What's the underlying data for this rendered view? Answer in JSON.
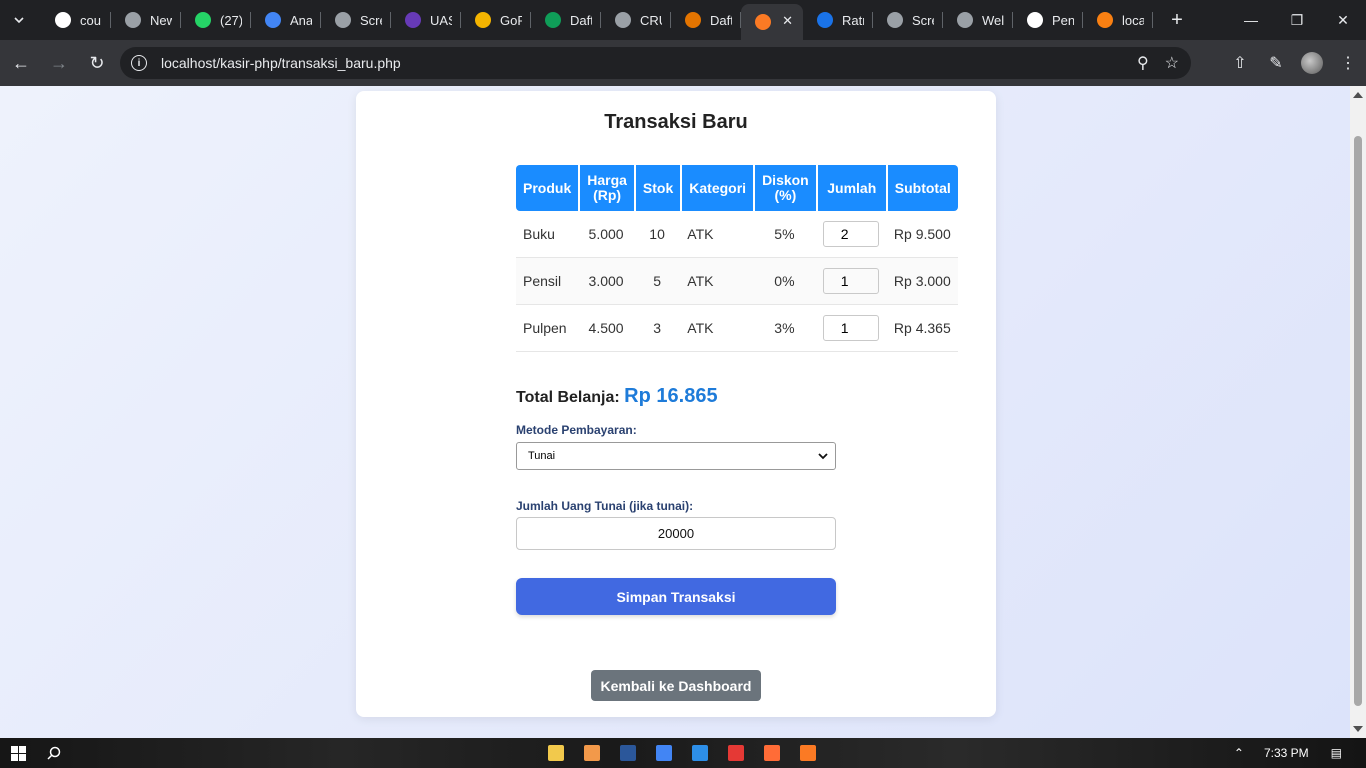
{
  "browser": {
    "tabs": [
      {
        "title": "cou",
        "icon": "google-icon",
        "color": "#ffffff"
      },
      {
        "title": "New",
        "icon": "chrome-icon",
        "color": "#9aa0a6"
      },
      {
        "title": "(27)",
        "icon": "whatsapp-icon",
        "color": "#25d366"
      },
      {
        "title": "Ana",
        "icon": "analytics-icon",
        "color": "#4285f4"
      },
      {
        "title": "Scre",
        "icon": "camera-icon",
        "color": "#9aa0a6"
      },
      {
        "title": "UAS",
        "icon": "forms-icon",
        "color": "#673ab7"
      },
      {
        "title": "GoF",
        "icon": "slides-icon",
        "color": "#f4b400"
      },
      {
        "title": "Daft",
        "icon": "sheets-icon",
        "color": "#0f9d58"
      },
      {
        "title": "CRU",
        "icon": "web-icon",
        "color": "#9aa0a6"
      },
      {
        "title": "Daft",
        "icon": "chart-icon",
        "color": "#e37400"
      },
      {
        "title": "",
        "icon": "xampp-icon",
        "color": "#fb7a24",
        "active": true
      },
      {
        "title": "Ratr",
        "icon": "canva-icon",
        "color": "#1a73e8"
      },
      {
        "title": "Scre",
        "icon": "camera-icon",
        "color": "#9aa0a6"
      },
      {
        "title": "Wel",
        "icon": "camera-icon",
        "color": "#9aa0a6"
      },
      {
        "title": "Peng",
        "icon": "github-icon",
        "color": "#ffffff"
      },
      {
        "title": "loca",
        "icon": "moodle-icon",
        "color": "#f98012"
      }
    ],
    "url": "localhost/kasir-php/transaksi_baru.php"
  },
  "page": {
    "title": "Transaksi Baru",
    "table": {
      "headers": [
        "Produk",
        "Harga (Rp)",
        "Stok",
        "Kategori",
        "Diskon (%)",
        "Jumlah",
        "Subtotal"
      ],
      "rows": [
        {
          "produk": "Buku",
          "harga": "5.000",
          "stok": "10",
          "kategori": "ATK",
          "diskon": "5%",
          "jumlah": "2",
          "subtotal": "Rp 9.500"
        },
        {
          "produk": "Pensil",
          "harga": "3.000",
          "stok": "5",
          "kategori": "ATK",
          "diskon": "0%",
          "jumlah": "1",
          "subtotal": "Rp 3.000"
        },
        {
          "produk": "Pulpen",
          "harga": "4.500",
          "stok": "3",
          "kategori": "ATK",
          "diskon": "3%",
          "jumlah": "1",
          "subtotal": "Rp 4.365"
        }
      ]
    },
    "total_label": "Total Belanja:",
    "total_value": "Rp 16.865",
    "payment_label": "Metode Pembayaran:",
    "payment_selected": "Tunai",
    "cash_label": "Jumlah Uang Tunai (jika tunai):",
    "cash_value": "20000",
    "save_button": "Simpan Transaksi",
    "back_button": "Kembali ke Dashboard"
  },
  "colors": {
    "table_header": "#1a8cff",
    "total": "#1e7bd9",
    "save_button": "#4169e1",
    "back_button": "#6b747c"
  },
  "taskbar": {
    "apps": [
      "file-explorer-icon",
      "media-player-icon",
      "word-icon",
      "chrome-icon",
      "vscode-icon",
      "filezilla-icon",
      "postman-icon",
      "xampp-icon"
    ],
    "time": "7:33 PM"
  }
}
